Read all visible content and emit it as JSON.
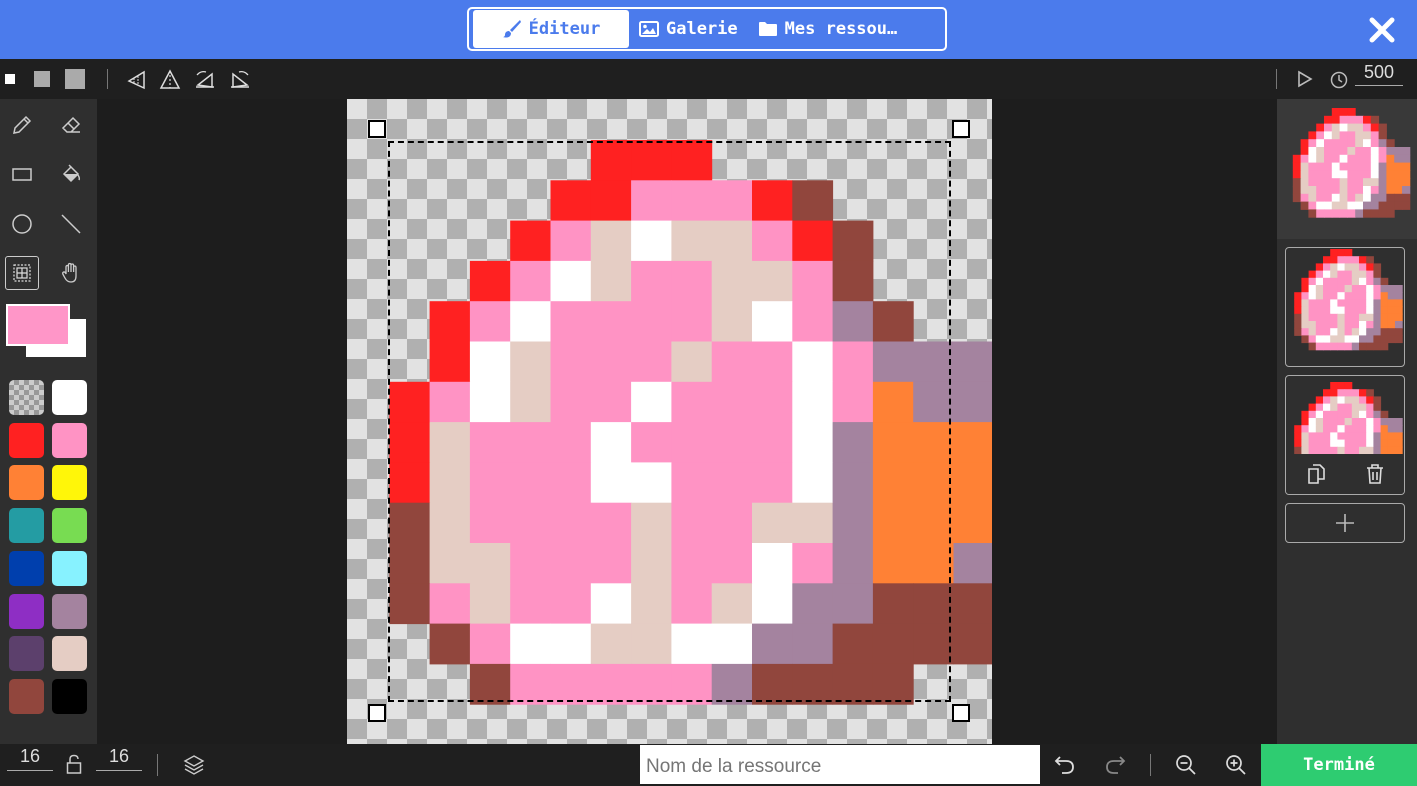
{
  "header": {
    "tabs": [
      {
        "label": "Éditeur",
        "icon": "paintbrush-icon",
        "active": true
      },
      {
        "label": "Galerie",
        "icon": "image-icon",
        "active": false
      },
      {
        "label": "Mes ressou…",
        "icon": "folder-icon",
        "active": false
      }
    ],
    "close_icon": "close-icon"
  },
  "toolbar": {
    "brush_sizes": [
      "small",
      "medium",
      "large"
    ],
    "transform_tools": [
      "rotate-icon",
      "flip-horizontal-icon",
      "flip-vertical-icon",
      "rotate-ccw-icon"
    ],
    "play_icon": "play-icon",
    "timer_icon": "clock-icon",
    "interval": "500"
  },
  "tools": [
    "pencil",
    "eraser",
    "rectangle",
    "fill",
    "circle",
    "line",
    "marquee",
    "pan"
  ],
  "selected_tool": "marquee",
  "colors": {
    "primary": "#ff96c8",
    "secondary": "#ffffff",
    "palette": [
      "transparent",
      "#ffffff",
      "#ff2121",
      "#ff93c4",
      "#ff8135",
      "#fff609",
      "#249ca3",
      "#78dc52",
      "#003fad",
      "#87f2ff",
      "#8e2ec4",
      "#a4839f",
      "#5c406c",
      "#e5cdc4",
      "#91463d",
      "#000000"
    ]
  },
  "sprite": {
    "width": 16,
    "height": 16,
    "palette": {
      ".": "transparent",
      "W": "#ffffff",
      "R": "#ff2121",
      "P": "#ff93c4",
      "O": "#ff8135",
      "V": "#a4839f",
      "B": "#e5cdc4",
      "D": "#91463d"
    },
    "rows": [
      "......RRR.......",
      ".....RRPPPRD....",
      "....RPBWBBPRD...",
      "...RPWBPPBBPD...",
      "..RPWPPPPBWPVD..",
      "..RWBPPPBPPWPVVV",
      ".RPWBPPWPPPWPOVV",
      ".RBPPPWPPPPWVOOO",
      ".RBPPPWWPPPWVOOO",
      ".DBPPPPBPPBBVOOO",
      ".DBBPPPBPPWPVOOV",
      ".DPBPPWBPBWVVDDD",
      "..DPWWBBWWVVDDDD",
      "...DPPPPPVDDDD..",
      "................",
      "................"
    ]
  },
  "frames": [
    {
      "label": "frame-1"
    },
    {
      "label": "frame-2"
    }
  ],
  "frame_actions": [
    "duplicate-icon",
    "trash-icon"
  ],
  "bottom": {
    "width_value": "16",
    "height_value": "16",
    "name_placeholder": "Nom de la ressource",
    "done_label": "Terminé"
  }
}
